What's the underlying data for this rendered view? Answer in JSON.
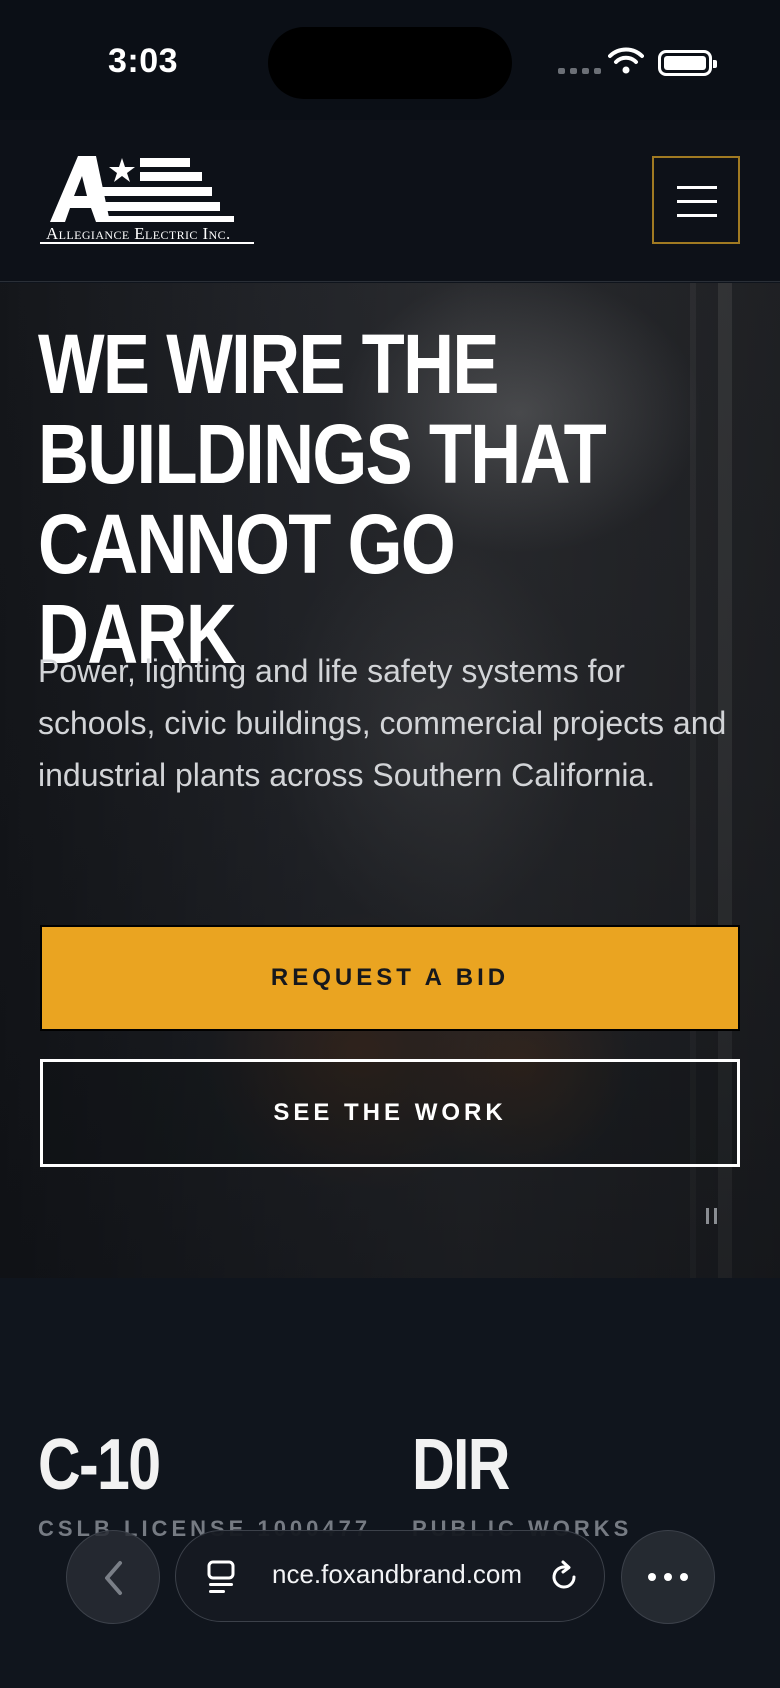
{
  "status_bar": {
    "time": "3:03"
  },
  "header": {
    "logo_text": "Allegiance Electric Inc.",
    "menu_icon": "hamburger-menu-icon"
  },
  "hero": {
    "title_lines": [
      "WE WIRE THE",
      "BUILDINGS THAT",
      "CANNOT GO DARK"
    ],
    "subtitle": "Power, lighting and life safety systems for schools, civic buildings, commercial projects and industrial plants across Southern California.",
    "primary_button": "REQUEST A BID",
    "secondary_button": "SEE THE WORK",
    "pause_icon": "pause-icon"
  },
  "stats": [
    {
      "value": "C-10",
      "label": "CSLB LICENSE 1000477"
    },
    {
      "value": "DIR",
      "label": "PUBLIC WORKS"
    }
  ],
  "browser": {
    "url": "nce.foxandbrand.com",
    "back_icon": "chevron-left-icon",
    "tabs_icon": "tabs-icon",
    "reload_icon": "reload-icon",
    "more_icon": "more-dots-icon"
  },
  "colors": {
    "accent": "#EAA421",
    "background": "#0F141C",
    "menu_border": "#A07A22"
  }
}
